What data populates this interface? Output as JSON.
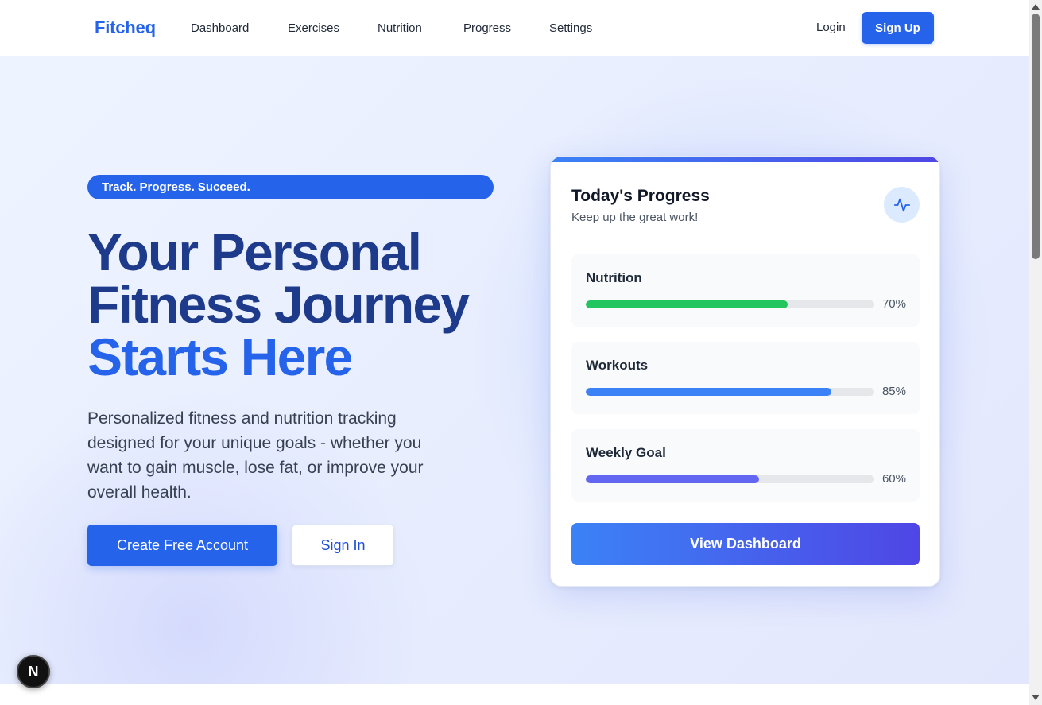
{
  "nav": {
    "logo": "Fitcheq",
    "links": [
      "Dashboard",
      "Exercises",
      "Nutrition",
      "Progress",
      "Settings"
    ],
    "login": "Login",
    "signup": "Sign Up"
  },
  "hero": {
    "tagline": "Track. Progress. Succeed.",
    "headline_line1": "Your Personal",
    "headline_line2": "Fitness Journey",
    "headline_accent": "Starts Here",
    "description": "Personalized fitness and nutrition tracking designed for your unique goals - whether you want to gain muscle, lose fat, or improve your overall health.",
    "primary_cta": "Create Free Account",
    "secondary_cta": "Sign In"
  },
  "card": {
    "title": "Today's Progress",
    "subtitle": "Keep up the great work!",
    "icon": "activity-pulse-icon",
    "metrics": [
      {
        "label": "Nutrition",
        "value": 70,
        "display": "70%",
        "color": "#22c55e"
      },
      {
        "label": "Workouts",
        "value": 85,
        "display": "85%",
        "color": "#3b82f6"
      },
      {
        "label": "Weekly Goal",
        "value": 60,
        "display": "60%",
        "color": "#6366f1"
      }
    ],
    "button": "View Dashboard"
  },
  "badge": {
    "letter": "N",
    "icon": "nextjs-logo-icon"
  },
  "colors": {
    "brand": "#2563eb",
    "headline": "#1e3a8a",
    "gradient_start": "#3b82f6",
    "gradient_end": "#4f46e5"
  }
}
